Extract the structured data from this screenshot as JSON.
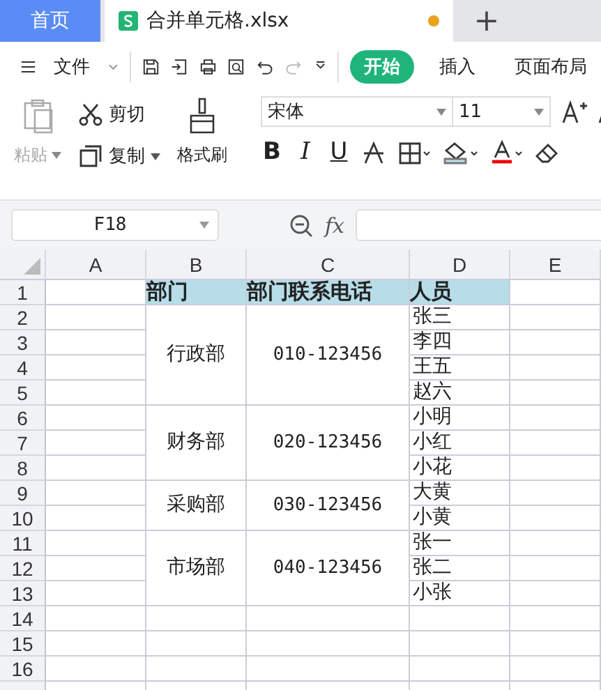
{
  "tabs": [
    {
      "label": "首页",
      "kind": "home",
      "selected": false
    },
    {
      "label": "合并单元格.xlsx",
      "kind": "file",
      "selected": true,
      "unsaved": true
    }
  ],
  "new_tab": "+",
  "menu": {
    "file_menu": "文件",
    "tabs": [
      {
        "label": "开始",
        "selected": true
      },
      {
        "label": "插入",
        "selected": false
      },
      {
        "label": "页面布局",
        "selected": false
      }
    ]
  },
  "ribbon": {
    "paste": {
      "label": "粘贴",
      "disabled": true
    },
    "cut": "剪切",
    "copy": "复制",
    "format_painter": "格式刷",
    "font_name": "宋体",
    "font_size": "11",
    "style_buttons": [
      "B",
      "I",
      "U"
    ]
  },
  "formula_bar": {
    "name_box": "F18",
    "fx": "fx"
  },
  "sheet": {
    "columns": [
      "A",
      "B",
      "C",
      "D",
      "E"
    ],
    "row_numbers": [
      "1",
      "2",
      "3",
      "4",
      "5",
      "6",
      "7",
      "8",
      "9",
      "10",
      "11",
      "12",
      "13",
      "14",
      "15",
      "16"
    ],
    "header": [
      "部门",
      "部门联系电话",
      "人员"
    ],
    "departments": [
      {
        "name": "行政部",
        "phone": "010-123456",
        "members": [
          "张三",
          "李四",
          "王五",
          "赵六"
        ]
      },
      {
        "name": "财务部",
        "phone": "020-123456",
        "members": [
          "小明",
          "小红",
          "小花"
        ]
      },
      {
        "name": "采购部",
        "phone": "030-123456",
        "members": [
          "大黄",
          "小黄"
        ]
      },
      {
        "name": "市场部",
        "phone": "040-123456",
        "members": [
          "张一",
          "张二",
          "小张"
        ]
      }
    ]
  }
}
